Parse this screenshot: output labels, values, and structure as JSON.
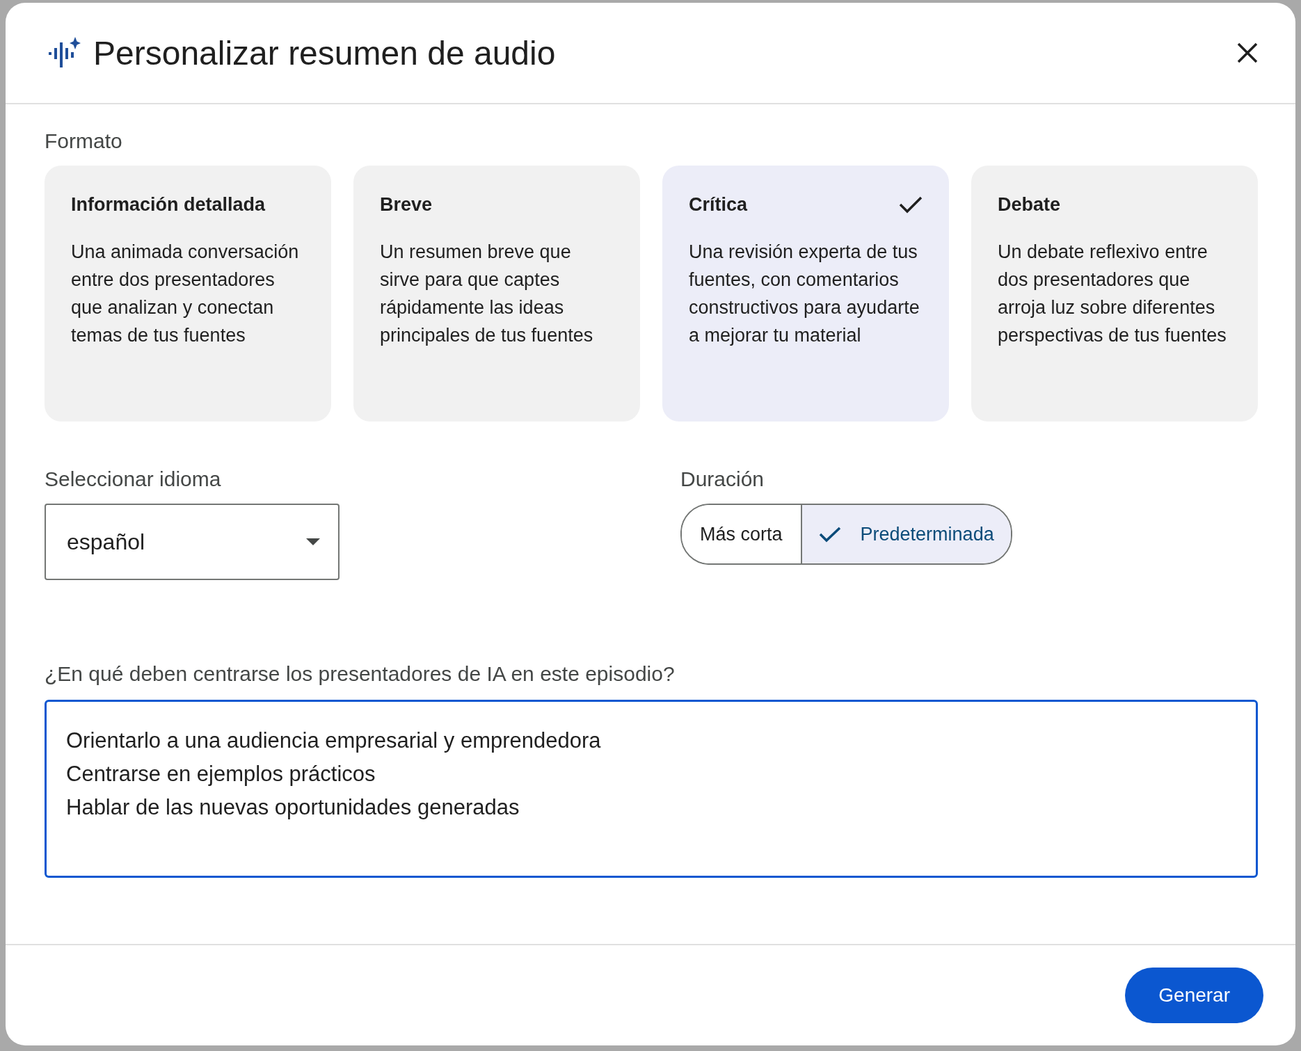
{
  "dialog": {
    "title": "Personalizar resumen de audio"
  },
  "format": {
    "label": "Formato",
    "options": [
      {
        "title": "Información detallada",
        "description": "Una animada conversación entre dos presentadores que analizan y conectan temas de tus fuentes",
        "selected": false
      },
      {
        "title": "Breve",
        "description": "Un resumen breve que sirve para que captes rápidamente las ideas principales de tus fuentes",
        "selected": false
      },
      {
        "title": "Crítica",
        "description": "Una revisión experta de tus fuentes, con comentarios constructivos para ayudarte a mejorar tu material",
        "selected": true
      },
      {
        "title": "Debate",
        "description": "Un debate reflexivo entre dos presentadores que arroja luz sobre diferentes perspectivas de tus fuentes",
        "selected": false
      }
    ]
  },
  "language": {
    "label": "Seleccionar idioma",
    "value": "español"
  },
  "duration": {
    "label": "Duración",
    "options": [
      {
        "label": "Más corta",
        "selected": false
      },
      {
        "label": "Predeterminada",
        "selected": true
      }
    ]
  },
  "focus": {
    "label": "¿En qué deben centrarse los presentadores de IA en este episodio?",
    "value": "Orientarlo a una audiencia empresarial y emprendedora\nCentrarse en ejemplos prácticos\nHablar de las nuevas oportunidades generadas"
  },
  "buttons": [
    {
      "label": "Generar"
    }
  ]
}
